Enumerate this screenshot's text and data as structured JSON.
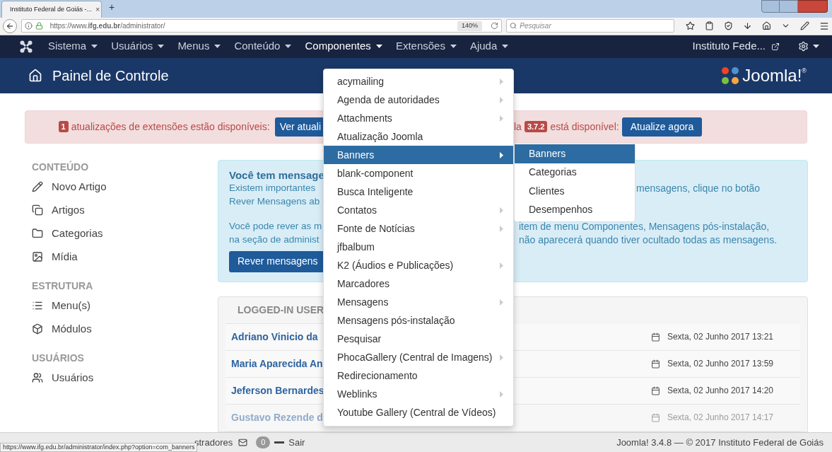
{
  "browser": {
    "tab": {
      "title": "Instituto Federal de Goiás -...",
      "close": "×"
    },
    "new_tab": "+",
    "url": "https://www.**ifg.edu.br**/administrator/",
    "zoom": "140%",
    "search": {
      "placeholder": "Pesquisar"
    },
    "status_url": "https://www.ifg.edu.br/administrator/index.php?option=com_banners"
  },
  "navbar": {
    "items": [
      {
        "label": "Sistema",
        "selected": false
      },
      {
        "label": "Usuários",
        "selected": false
      },
      {
        "label": "Menus",
        "selected": false
      },
      {
        "label": "Conteúdo",
        "selected": false
      },
      {
        "label": "Componentes",
        "selected": true
      },
      {
        "label": "Extensões",
        "selected": false
      },
      {
        "label": "Ajuda",
        "selected": false
      }
    ],
    "site": "Instituto Fede..."
  },
  "header": {
    "title": "Painel de Controle",
    "logo": "Joomla!",
    "logo_mark": "®"
  },
  "alert": {
    "count": "1",
    "text": "atualizações de extensões estão disponíveis:",
    "button": "Ver atuali",
    "text_2": "la",
    "version": "3.7.2",
    "text_3": "está disponível:",
    "button_2": "Atualize agora"
  },
  "sidebar": {
    "sections": [
      {
        "title": "CONTEÚDO",
        "items": [
          "Novo Artigo",
          "Artigos",
          "Categorias",
          "Mídia"
        ]
      },
      {
        "title": "ESTRUTURA",
        "items": [
          "Menu(s)",
          "Módulos"
        ]
      },
      {
        "title": "USUÁRIOS",
        "items": [
          "Usuários"
        ]
      }
    ]
  },
  "messages": {
    "title": "Você tem mensage",
    "paragraphs": [
      [
        {
          "left": "Existem importantes",
          "right": "mensagens, clique no botão"
        },
        {
          "left": "Rever Mensagens ab"
        }
      ],
      [
        {
          "left": "Você pode rever as m",
          "right": "item de menu Componentes, Mensagens pós-instalação,"
        },
        {
          "left": "na seção de administ",
          "right": "não aparecerá quando tiver ocultado todas as mensagens."
        }
      ]
    ],
    "button": "Rever mensagens"
  },
  "logged_in": {
    "title": "LOGGED-IN USER",
    "rows": [
      {
        "name": "Adriano Vinicio da",
        "date": "Sexta, 02 Junho 2017 13:21"
      },
      {
        "name": "Maria Aparecida An",
        "date": "Sexta, 02 Junho 2017 13:59"
      },
      {
        "name": "Jeferson Bernardes",
        "date": "Sexta, 02 Junho 2017 14:20"
      },
      {
        "name": "Gustavo Rezende d",
        "date": "Sexta, 02 Junho 2017 14:17"
      }
    ]
  },
  "dropdown": {
    "items": [
      {
        "label": "acymailing",
        "submenu": true,
        "selected": false
      },
      {
        "label": "Agenda de autoridades",
        "submenu": true,
        "selected": false
      },
      {
        "label": "Attachments",
        "submenu": true,
        "selected": false
      },
      {
        "label": "Atualização Joomla",
        "submenu": false,
        "selected": false
      },
      {
        "label": "Banners",
        "submenu": true,
        "selected": true
      },
      {
        "label": "blank-component",
        "submenu": false,
        "selected": false
      },
      {
        "label": "Busca Inteligente",
        "submenu": false,
        "selected": false
      },
      {
        "label": "Contatos",
        "submenu": true,
        "selected": false
      },
      {
        "label": "Fonte de Notícias",
        "submenu": true,
        "selected": false
      },
      {
        "label": "jfbalbum",
        "submenu": false,
        "selected": false
      },
      {
        "label": "K2 (Áudios e Publicações)",
        "submenu": true,
        "selected": false
      },
      {
        "label": "Marcadores",
        "submenu": false,
        "selected": false
      },
      {
        "label": "Mensagens",
        "submenu": true,
        "selected": false
      },
      {
        "label": "Mensagens pós-instalação",
        "submenu": false,
        "selected": false
      },
      {
        "label": "Pesquisar",
        "submenu": false,
        "selected": false
      },
      {
        "label": "PhocaGallery (Central de Imagens)",
        "submenu": true,
        "selected": false
      },
      {
        "label": "Redirecionamento",
        "submenu": false,
        "selected": false
      },
      {
        "label": "Weblinks",
        "submenu": true,
        "selected": false
      },
      {
        "label": "Youtube Gallery (Central de Vídeos)",
        "submenu": false,
        "selected": false
      }
    ]
  },
  "submenu": {
    "items": [
      {
        "label": "Banners",
        "selected": true
      },
      {
        "label": "Categorias",
        "selected": false
      },
      {
        "label": "Clientes",
        "selected": false
      },
      {
        "label": "Desempenhos",
        "selected": false
      }
    ]
  },
  "footer": {
    "text": "stradores",
    "count": "0",
    "logout": "Sair",
    "copyright": "Joomla! 3.4.8 — © 2017 Instituto Federal de Goiás"
  }
}
